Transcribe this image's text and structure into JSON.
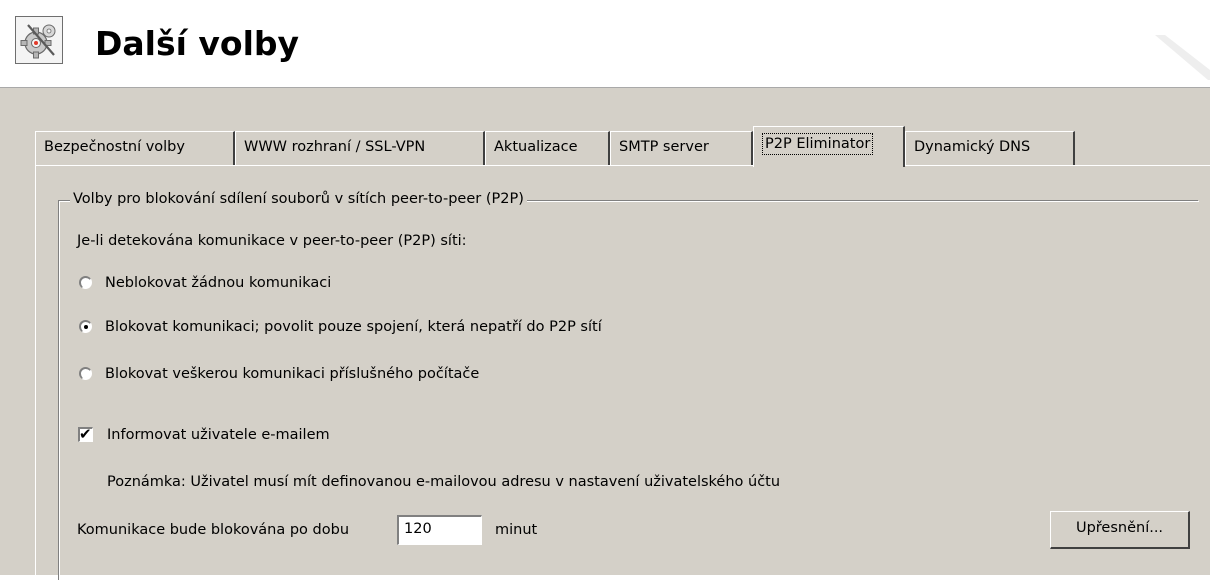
{
  "header": {
    "title": "Další volby",
    "icon": "gears-tools-icon"
  },
  "tabs": [
    {
      "label": "Bezpečnostní volby",
      "active": false
    },
    {
      "label": "WWW rozhraní / SSL-VPN",
      "active": false
    },
    {
      "label": "Aktualizace",
      "active": false
    },
    {
      "label": "SMTP server",
      "active": false
    },
    {
      "label": "P2P Eliminator",
      "active": true
    },
    {
      "label": "Dynamický DNS",
      "active": false
    }
  ],
  "group": {
    "legend": "Volby pro blokování sdílení souborů v sítích peer-to-peer (P2P)",
    "intro": "Je-li detekována komunikace v peer-to-peer (P2P) síti:",
    "options": [
      {
        "label": "Neblokovat žádnou komunikaci",
        "checked": false
      },
      {
        "label": "Blokovat komunikaci; povolit pouze spojení, která nepatří do P2P sítí",
        "checked": true
      },
      {
        "label": "Blokovat veškerou komunikaci příslušného počítače",
        "checked": false
      }
    ],
    "notify": {
      "label": "Informovat uživatele e-mailem",
      "checked": true
    },
    "note": "Poznámka: Uživatel musí mít definovanou e-mailovou adresu v nastavení uživatelského účtu",
    "duration": {
      "label": "Komunikace bude blokována po dobu",
      "value": "120",
      "unit": "minut"
    },
    "advanced_button": "Upřesnění..."
  },
  "colors": {
    "panel_bg": "#d4d0c8",
    "header_bg": "#ffffff"
  }
}
